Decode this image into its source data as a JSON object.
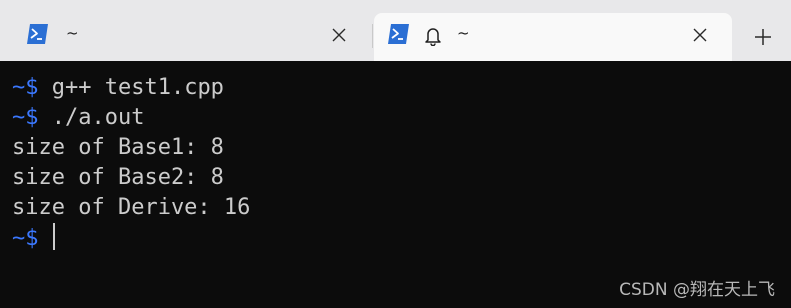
{
  "tabs": [
    {
      "title": "~",
      "icon": "powershell-icon",
      "active": false
    },
    {
      "title": "~",
      "icon": "powershell-icon",
      "bell": "bell-icon",
      "active": true
    }
  ],
  "new_tab_icon": "plus-icon",
  "terminal": {
    "prompt": "~$",
    "lines": [
      {
        "kind": "command",
        "prompt": "~$",
        "text": " g++ test1.cpp"
      },
      {
        "kind": "command",
        "prompt": "~$",
        "text": " ./a.out"
      },
      {
        "kind": "output",
        "text": "size of Base1: 8"
      },
      {
        "kind": "output",
        "text": "size of Base2: 8"
      },
      {
        "kind": "output",
        "text": "size of Derive: 16"
      },
      {
        "kind": "command",
        "prompt": "~$",
        "text": ""
      }
    ]
  },
  "watermark": "CSDN @翔在天上飞",
  "colors": {
    "background": "#0c0c0c",
    "foreground": "#cccccc",
    "prompt": "#3b78ff",
    "tabbar": "#e8e8ea",
    "active_tab": "#f9f9f9",
    "icon_blue": "#2b6fd4"
  }
}
